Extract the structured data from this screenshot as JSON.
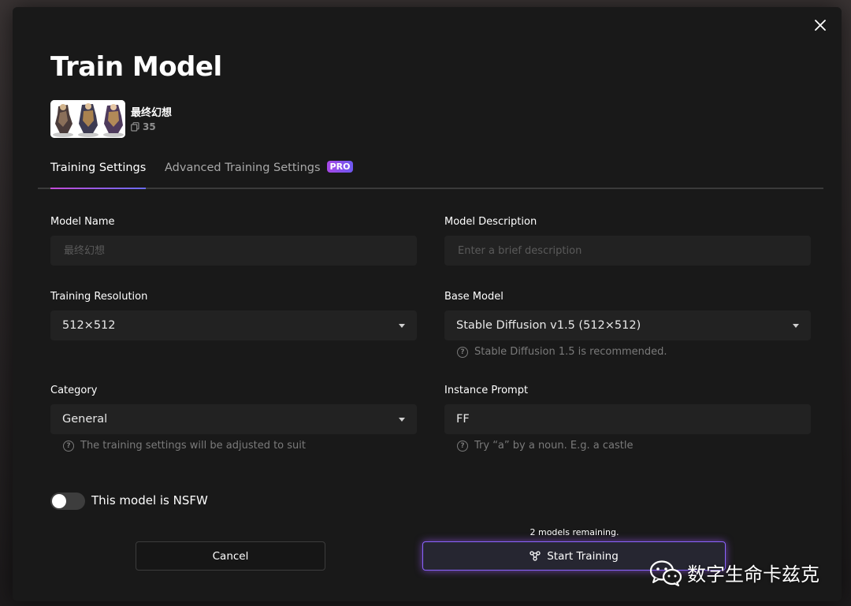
{
  "dialog": {
    "title": "Train Model",
    "close_icon": "close-icon"
  },
  "dataset": {
    "name": "最终幻想",
    "count": "35",
    "count_icon": "copy-icon"
  },
  "tabs": [
    {
      "label": "Training Settings",
      "active": true
    },
    {
      "label": "Advanced Training Settings",
      "badge": "PRO",
      "active": false
    }
  ],
  "form": {
    "model_name": {
      "label": "Model Name",
      "placeholder": "最终幻想",
      "value": ""
    },
    "model_description": {
      "label": "Model Description",
      "placeholder": "Enter a brief description",
      "value": ""
    },
    "training_resolution": {
      "label": "Training Resolution",
      "value": "512×512"
    },
    "base_model": {
      "label": "Base Model",
      "value": "Stable Diffusion v1.5 (512×512)",
      "hint": "Stable Diffusion 1.5 is recommended."
    },
    "category": {
      "label": "Category",
      "value": "General",
      "hint": "The training settings will be adjusted to suit"
    },
    "instance_prompt": {
      "label": "Instance Prompt",
      "value": "FF",
      "hint": "Try “a” by a noun. E.g. a castle"
    }
  },
  "nsfw": {
    "label": "This model is NSFW",
    "enabled": false
  },
  "footer": {
    "remaining": "2 models remaining.",
    "cancel_label": "Cancel",
    "start_label": "Start Training",
    "start_icon": "training-icon"
  },
  "watermark": {
    "text": "数字生命卡兹克",
    "icon": "wechat-icon"
  },
  "colors": {
    "dialog_bg": "#191919",
    "field_bg": "#222222",
    "accent_purple": "#8b63ff",
    "pro_badge": "#a748e6",
    "tab_underline_start": "#c34bd8",
    "tab_underline_end": "#6a6cf0"
  }
}
